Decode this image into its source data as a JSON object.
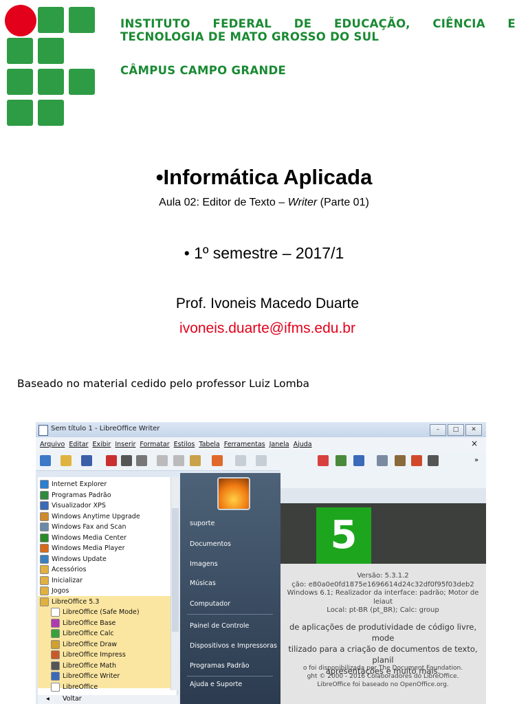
{
  "header": {
    "institute_line1": "INSTITUTO FEDERAL DE EDUCAÇÃO, CIÊNCIA E",
    "institute_line2": "TECNOLOGIA DE MATO GROSSO DO SUL",
    "campus": "CÂMPUS CAMPO GRANDE"
  },
  "slide": {
    "title": "•Informática Aplicada",
    "subtitle_prefix": "Aula 02: Editor de Texto – ",
    "subtitle_italic": "Writer",
    "subtitle_suffix": " (Parte 01)",
    "semester": "• 1º semestre – 2017/1",
    "professor": "Prof. Ivoneis Macedo Duarte",
    "email": "ivoneis.duarte@ifms.edu.br",
    "based_on": "Baseado no material cedido pelo professor Luiz Lomba"
  },
  "colors": {
    "institute_green": "#1a8a33",
    "logo_red": "#e3001b",
    "email_red": "#e3001b"
  },
  "screenshot": {
    "window_title": "Sem título 1 - LibreOffice Writer",
    "menu": [
      "Arquivo",
      "Editar",
      "Exibir",
      "Inserir",
      "Formatar",
      "Estilos",
      "Tabela",
      "Ferramentas",
      "Janela",
      "Ajuda"
    ],
    "close_glyph": "×",
    "programs": [
      "Internet Explorer",
      "Programas Padrão",
      "Visualizador XPS",
      "Windows Anytime Upgrade",
      "Windows Fax and Scan",
      "Windows Media Center",
      "Windows Media Player",
      "Windows Update",
      "Acessórios",
      "Inicializar",
      "Jogos",
      "LibreOffice 5.3",
      "LibreOffice (Safe Mode)",
      "LibreOffice Base",
      "LibreOffice Calc",
      "LibreOffice Draw",
      "LibreOffice Impress",
      "LibreOffice Math",
      "LibreOffice Writer",
      "LibreOffice"
    ],
    "back_label": "Voltar",
    "right_items": [
      "suporte",
      "Documentos",
      "Imagens",
      "Músicas",
      "Computador",
      "Painel de Controle",
      "Dispositivos e Impressoras",
      "Programas Padrão",
      "Ajuda e Suporte"
    ],
    "splash_number": "5",
    "about": {
      "version": "Versão: 5.3.1.2",
      "build": "ção: e80a0e0fd1875e1696614d24c32df0f95f03deb2",
      "env": "Windows 6.1; Realizador da interface: padrão; Motor de leiaut",
      "locale": "Local: pt-BR (pt_BR); Calc: group",
      "desc1": "de aplicações de produtividade de código livre, mode",
      "desc2": "tilizado para a criação de documentos de texto, planil",
      "desc3": "apresentações e muito mais.",
      "credit1": "o foi disponibilizada por The Document Foundation.",
      "credit2": "ght © 2000 - 2016 Colaboradores do LibreOffice.",
      "credit3": "LibreOffice foi baseado no OpenOffice.org."
    }
  }
}
